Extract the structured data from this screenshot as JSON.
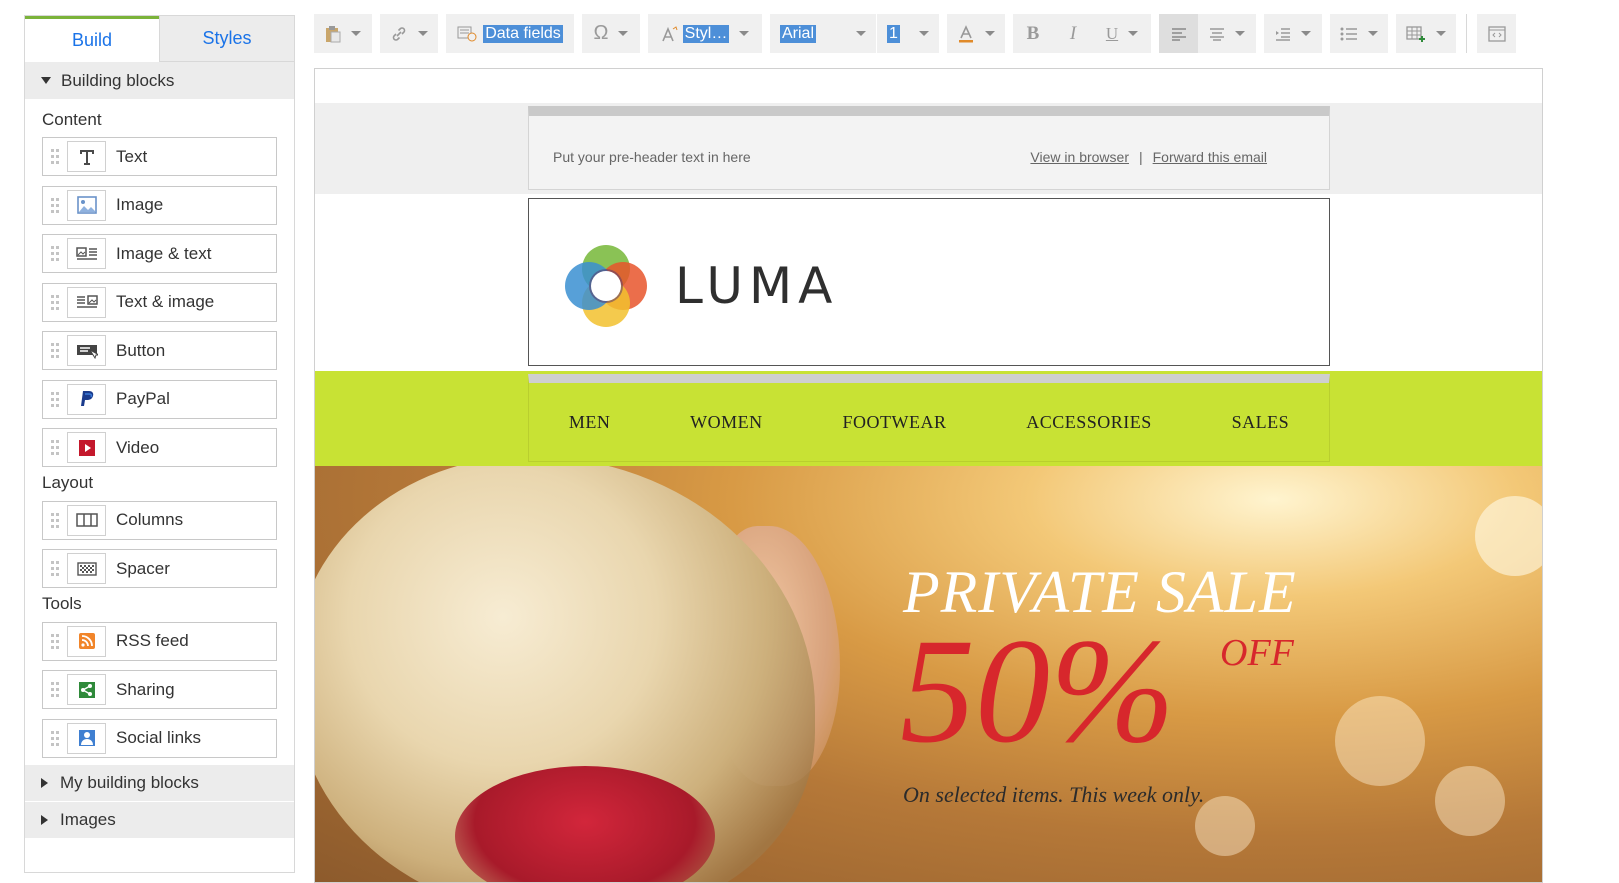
{
  "sidebar": {
    "tabs": [
      {
        "label": "Build",
        "active": true
      },
      {
        "label": "Styles",
        "active": false
      }
    ],
    "building_blocks_label": "Building blocks",
    "groups": {
      "content": {
        "title": "Content",
        "items": [
          {
            "label": "Text",
            "icon": "text-icon"
          },
          {
            "label": "Image",
            "icon": "image-icon"
          },
          {
            "label": "Image & text",
            "icon": "image-text-icon"
          },
          {
            "label": "Text & image",
            "icon": "text-image-icon"
          },
          {
            "label": "Button",
            "icon": "button-icon"
          },
          {
            "label": "PayPal",
            "icon": "paypal-icon"
          },
          {
            "label": "Video",
            "icon": "video-icon"
          }
        ]
      },
      "layout": {
        "title": "Layout",
        "items": [
          {
            "label": "Columns",
            "icon": "columns-icon"
          },
          {
            "label": "Spacer",
            "icon": "spacer-icon"
          }
        ]
      },
      "tools": {
        "title": "Tools",
        "items": [
          {
            "label": "RSS feed",
            "icon": "rss-icon"
          },
          {
            "label": "Sharing",
            "icon": "sharing-icon"
          },
          {
            "label": "Social links",
            "icon": "social-links-icon"
          }
        ]
      }
    },
    "my_blocks_label": "My building blocks",
    "images_label": "Images"
  },
  "toolbar": {
    "data_fields": "Data fields",
    "styles": "Styl…",
    "font": "Arial",
    "size": "1",
    "bold": "B",
    "italic": "I",
    "underline": "U",
    "omega": "Ω"
  },
  "email": {
    "preheader_text": "Put your pre-header text in here",
    "view_in_browser": "View in browser",
    "separator": "|",
    "forward": "Forward this email",
    "logo_text": "LUMA",
    "nav": [
      "MEN",
      "WOMEN",
      "FOOTWEAR",
      "ACCESSORIES",
      "SALES"
    ],
    "hero": {
      "title": "PRIVATE SALE",
      "percent": "50%",
      "off": "OFF",
      "subtitle": "On selected items. This week only."
    }
  },
  "colors": {
    "tab_accent": "#7bb33a",
    "link_blue": "#1a73e8",
    "nav_green": "#c8e234",
    "promo_red": "#d7272c",
    "selection_blue": "#4d8fd8"
  }
}
